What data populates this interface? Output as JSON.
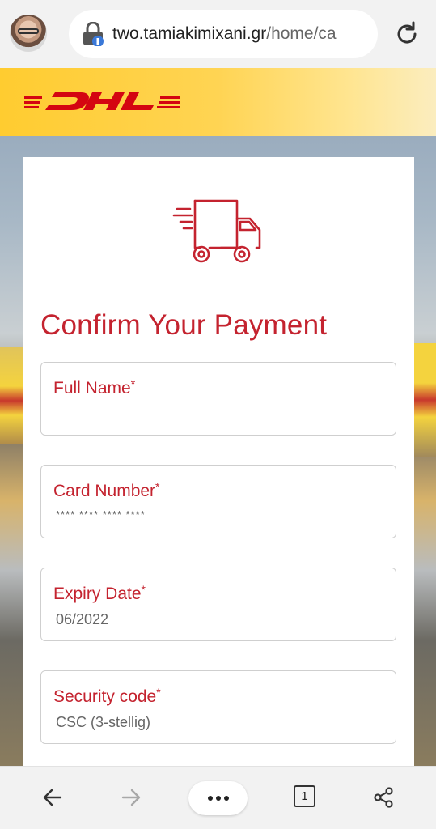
{
  "browser": {
    "url_domain": "two.tamiakimixani.gr",
    "url_path": "/home/ca",
    "tab_count": "1"
  },
  "brand": {
    "logo_text": "DHL",
    "primary_color": "#c4232f",
    "header_color": "#ffcc30"
  },
  "form": {
    "title": "Confirm Your Payment",
    "fields": [
      {
        "label": "Full Name",
        "required_mark": "*",
        "placeholder": ""
      },
      {
        "label": "Card Number",
        "required_mark": "*",
        "placeholder": "**** **** **** ****"
      },
      {
        "label": "Expiry Date",
        "required_mark": "*",
        "placeholder": "06/2022"
      },
      {
        "label": "Security code",
        "required_mark": "*",
        "placeholder": "CSC (3-stellig)"
      }
    ]
  },
  "icons": {
    "address_bar": "lock-icon",
    "reload": "reload-icon",
    "header_illustration": "delivery-truck-icon",
    "back": "back-arrow-icon",
    "forward": "forward-arrow-icon",
    "menu": "more-dots-icon",
    "tabs": "tabs-icon",
    "share": "share-icon"
  }
}
